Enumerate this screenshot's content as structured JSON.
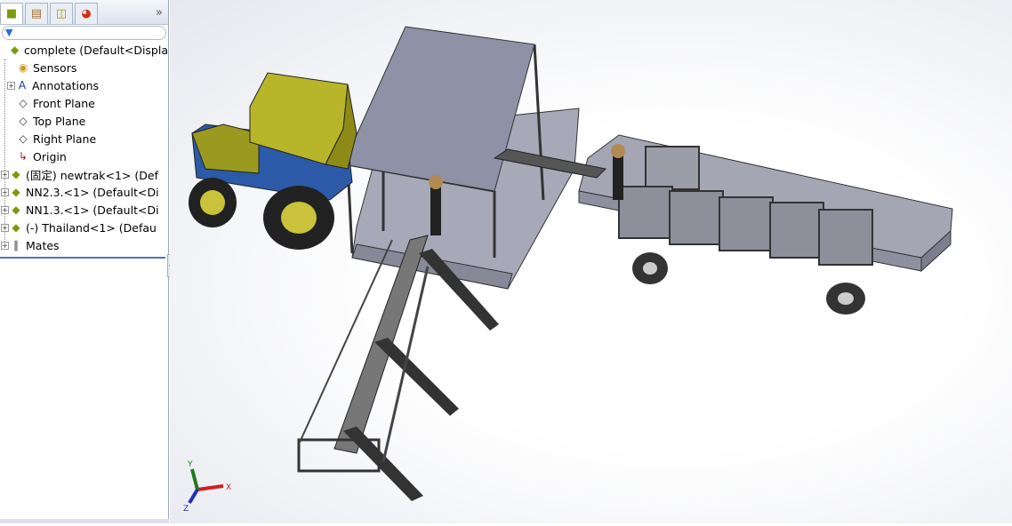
{
  "panel": {
    "tabs": [
      {
        "icon": "feature-manager-icon"
      },
      {
        "icon": "property-manager-icon"
      },
      {
        "icon": "configuration-manager-icon"
      },
      {
        "icon": "display-manager-icon"
      }
    ],
    "more": "»",
    "filter_icon": "filter-icon",
    "tree": [
      {
        "label": "complete  (Default<Displa",
        "icon": "assembly-icon",
        "expand": false
      },
      {
        "label": "Sensors",
        "icon": "sensors-folder-icon",
        "expand": false
      },
      {
        "label": "Annotations",
        "icon": "annotations-folder-icon",
        "expand": true
      },
      {
        "label": "Front Plane",
        "icon": "plane-icon",
        "expand": false
      },
      {
        "label": "Top Plane",
        "icon": "plane-icon",
        "expand": false
      },
      {
        "label": "Right Plane",
        "icon": "plane-icon",
        "expand": false
      },
      {
        "label": "Origin",
        "icon": "origin-icon",
        "expand": false
      },
      {
        "label": "(固定) newtrak<1> (Def",
        "icon": "subassembly-icon",
        "expand": true
      },
      {
        "label": "NN2.3.<1> (Default<Di",
        "icon": "subassembly-icon",
        "expand": true
      },
      {
        "label": "NN1.3.<1> (Default<Di",
        "icon": "subassembly-icon",
        "expand": true
      },
      {
        "label": "(-) Thailand<1> (Defau",
        "icon": "subassembly-icon",
        "expand": true
      },
      {
        "label": "Mates",
        "icon": "mates-icon",
        "expand": true
      }
    ]
  },
  "triad": {
    "x": "X",
    "y": "Y",
    "z": "Z",
    "colors": {
      "x": "#cc2020",
      "y": "#1f7a1f",
      "z": "#1f30c0"
    }
  }
}
